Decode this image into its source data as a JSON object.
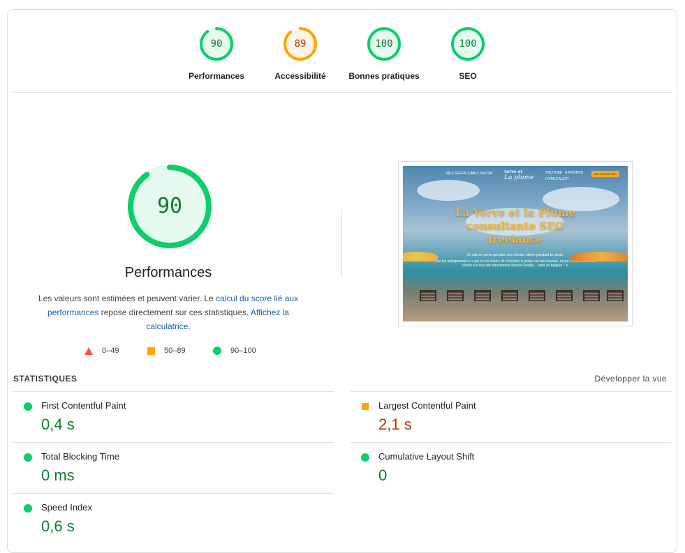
{
  "gauges": [
    {
      "score": "90",
      "label": "Performances",
      "color": "#0cce6b",
      "bg": "#e6f9ef",
      "text_color": "#0c7d2f",
      "fraction": 0.9
    },
    {
      "score": "89",
      "label": "Accessibilité",
      "color": "#ffa400",
      "bg": "#fff4e5",
      "text_color": "#c33300",
      "fraction": 0.89
    },
    {
      "score": "100",
      "label": "Bonnes pratiques",
      "color": "#0cce6b",
      "bg": "#e6f9ef",
      "text_color": "#0c7d2f",
      "fraction": 1.0
    },
    {
      "score": "100",
      "label": "SEO",
      "color": "#0cce6b",
      "bg": "#e6f9ef",
      "text_color": "#0c7d2f",
      "fraction": 1.0
    }
  ],
  "main": {
    "score": "90",
    "score_fraction": 0.9,
    "title": "Performances",
    "desc_part1": "Les valeurs sont estimées et peuvent varier. Le ",
    "desc_link1": "calcul du score lié aux performances",
    "desc_part2": " repose directement sur ces statistiques. ",
    "desc_link2": "Affichez la calculatrice",
    "desc_part3": "."
  },
  "legend": {
    "fail": "0–49",
    "average": "50–89",
    "pass": "90–100",
    "fail_color": "#ff4e42",
    "average_color": "#ffa400",
    "pass_color": "#0cce6b"
  },
  "screenshot": {
    "nav_left1": "MES SERVICES",
    "nav_left2": "MES SAVOIR",
    "logo_top": "verve et",
    "logo_bottom": "La plume",
    "nav_right1": "YOUTUBE",
    "nav_right2": "À PROPOS",
    "nav_right3": "LIVRES AUDIT",
    "cta": "ME CONTACTER",
    "hero_line1": "La Verve et la Plume",
    "hero_line2": "consultante SEO",
    "hero_line3": "freelance",
    "hero_sub1": "Un site en verve qui attire des clients, même pendant ta sieste.",
    "hero_sub2": "Pour les entrepreneur·e·s qui en ont marre de s'éreinter à poster sur les réseaux, et qui veulent attirer des clients sur leur site directement depuis Google... sans se fatiguer ! ☀"
  },
  "stats": {
    "title": "STATISTIQUES",
    "expand": "Développer la vue",
    "metrics": [
      {
        "title": "First Contentful Paint",
        "value": "0,4 s",
        "status": "pass"
      },
      {
        "title": "Largest Contentful Paint",
        "value": "2,1 s",
        "status": "average"
      },
      {
        "title": "Total Blocking Time",
        "value": "0 ms",
        "status": "pass"
      },
      {
        "title": "Cumulative Layout Shift",
        "value": "0",
        "status": "pass"
      },
      {
        "title": "Speed Index",
        "value": "0,6 s",
        "status": "pass"
      }
    ]
  },
  "colors": {
    "pass_text": "#0c7d2f",
    "average_text": "#c33300",
    "link": "#1a5fb4"
  }
}
